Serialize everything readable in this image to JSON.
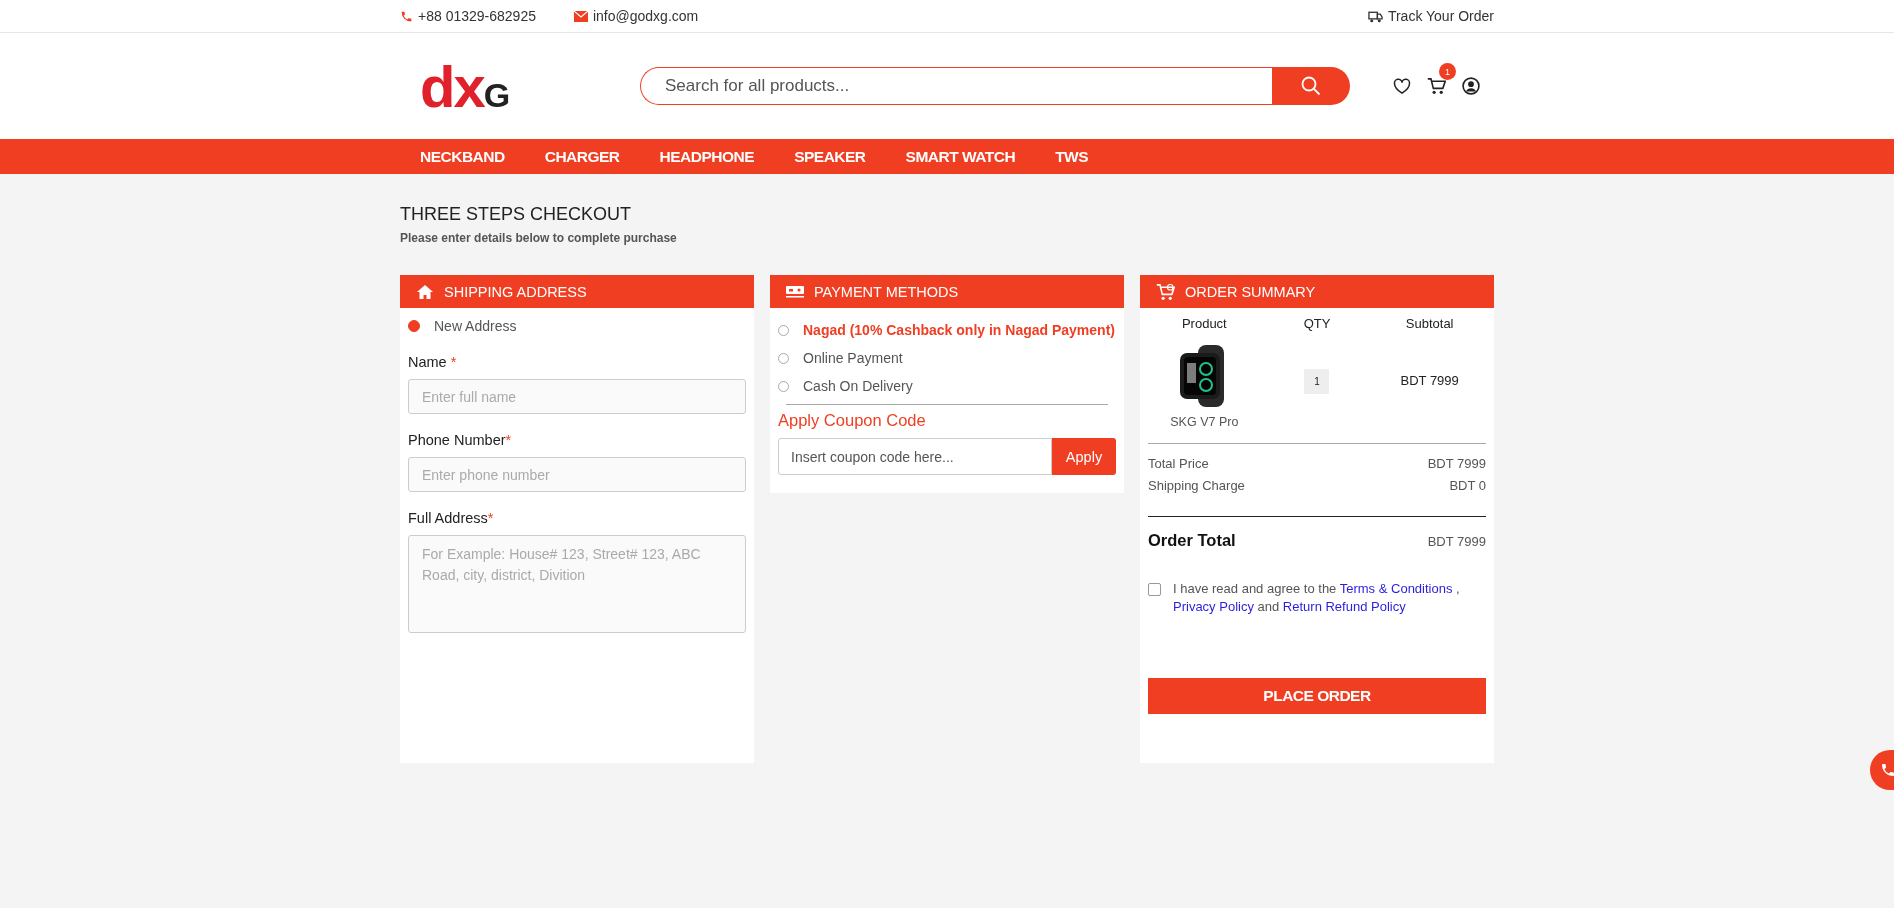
{
  "top_bar": {
    "phone": "+88 01329-682925",
    "email": "info@godxg.com",
    "track_order": "Track Your Order"
  },
  "header": {
    "logo": {
      "main": "dx",
      "accent": "G"
    },
    "search": {
      "placeholder": "Search for all products..."
    },
    "cart_count": "1"
  },
  "nav": [
    "NECKBAND",
    "CHARGER",
    "HEADPHONE",
    "SPEAKER",
    "SMART WATCH",
    "TWS"
  ],
  "page": {
    "title": "THREE STEPS CHECKOUT",
    "subtitle": "Please enter details below to complete purchase"
  },
  "shipping": {
    "title": "SHIPPING ADDRESS",
    "address_options": [
      {
        "label": "New Address",
        "selected": true
      }
    ],
    "fields": [
      {
        "kind": "input",
        "label": "Name ",
        "required_mark": "*",
        "placeholder": "Enter full name"
      },
      {
        "kind": "input",
        "label": "Phone Number",
        "required_mark": "*",
        "placeholder": "Enter phone number"
      },
      {
        "kind": "textarea",
        "label": "Full Address",
        "required_mark": "*",
        "placeholder": "For Example: House# 123, Street# 123, ABC Road, city, district, Divition"
      }
    ]
  },
  "payment": {
    "title": "PAYMENT METHODS",
    "methods": [
      {
        "label": "Nagad (10% Cashback only in Nagad Payment)",
        "highlight": true,
        "selected": false
      },
      {
        "label": "Online Payment",
        "highlight": false,
        "selected": false
      },
      {
        "label": "Cash On Delivery",
        "highlight": false,
        "selected": false
      }
    ],
    "coupon": {
      "title": "Apply Coupon Code",
      "placeholder": "Insert coupon code here...",
      "button": "Apply"
    }
  },
  "summary": {
    "title": "ORDER SUMMARY",
    "columns": [
      "Product",
      "QTY",
      "Subtotal"
    ],
    "items": [
      {
        "name": "SKG V7 Pro",
        "qty": "1",
        "subtotal": "BDT 7999"
      }
    ],
    "totals": [
      {
        "label": "Total Price",
        "value": "BDT 7999"
      },
      {
        "label": "Shipping Charge",
        "value": "BDT 0"
      }
    ],
    "order_total": {
      "label": "Order Total",
      "value": "BDT 7999"
    },
    "agreement": {
      "checked": false,
      "text": "I have read and agree to the",
      "terms": "Terms & Conditions",
      "comma": ",",
      "privacy": "Privacy Policy",
      "and": "and",
      "refund": "Return Refund Policy"
    },
    "button": "PLACE ORDER"
  }
}
